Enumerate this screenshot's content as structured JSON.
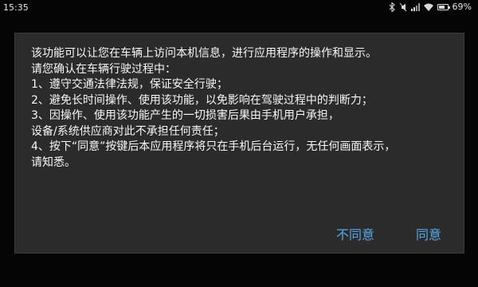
{
  "status_bar": {
    "time": "15:35",
    "icons": [
      "bluetooth-icon",
      "mute-icon",
      "signal-icon",
      "wifi-icon",
      "battery-icon"
    ],
    "battery_percent_text": "69%",
    "battery_level": 0.69
  },
  "dialog": {
    "lines": [
      "该功能可以让您在车辆上访问本机信息，进行应用程序的操作和显示。",
      "请您确认在车辆行驶过程中：",
      " 1、遵守交通法律法规，保证安全行驶；",
      " 2、避免长时间操作、使用该功能，以免影响在驾驶过程中的判断力；",
      " 3、因操作、使用该功能产生的一切损害后果由手机用户承担，",
      "设备/系统供应商对此不承担任何责任；",
      " 4、按下“同意”按键后本应用程序将只在手机后台运行，无任何画面表示，",
      "请知悉。"
    ],
    "disagree_label": "不同意",
    "agree_label": "同意",
    "button_color": "#55a9e8"
  }
}
